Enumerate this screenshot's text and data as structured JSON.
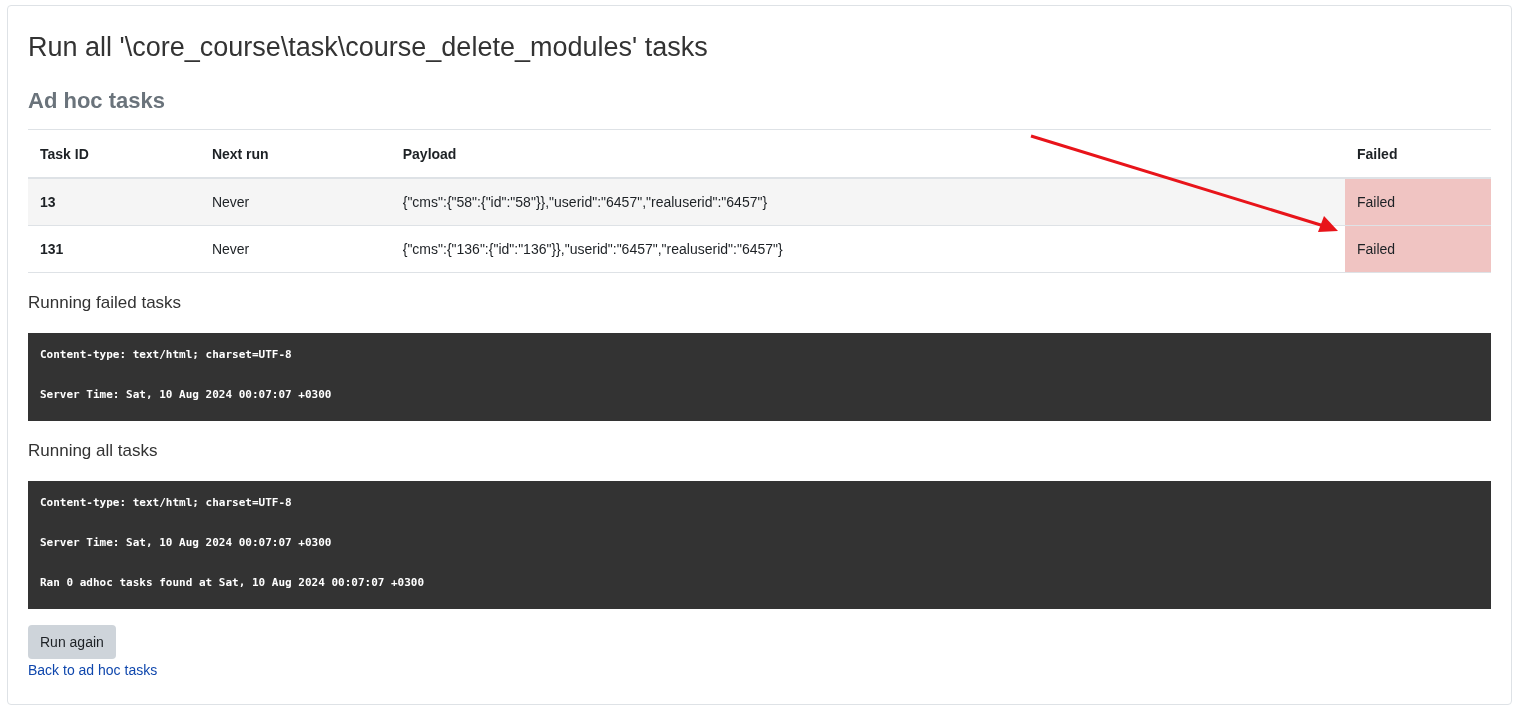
{
  "page": {
    "title": "Run all '\\core_course\\task\\course_delete_modules' tasks"
  },
  "section": {
    "heading": "Ad hoc tasks"
  },
  "table": {
    "columns": [
      "Task ID",
      "Next run",
      "Payload",
      "Failed"
    ],
    "rows": [
      {
        "task_id": "13",
        "next_run": "Never",
        "payload": "{\"cms\":{\"58\":{\"id\":\"58\"}},\"userid\":\"6457\",\"realuserid\":\"6457\"}",
        "failed": true,
        "status": "Failed"
      },
      {
        "task_id": "131",
        "next_run": "Never",
        "payload": "{\"cms\":{\"136\":{\"id\":\"136\"}},\"userid\":\"6457\",\"realuserid\":\"6457\"}",
        "failed": true,
        "status": "Failed"
      }
    ]
  },
  "outputs": [
    {
      "heading": "Running failed tasks",
      "lines": [
        "Content-type: text/html; charset=UTF-8",
        "Server Time: Sat, 10 Aug 2024 00:07:07 +0300"
      ]
    },
    {
      "heading": "Running all tasks",
      "lines": [
        "Content-type: text/html; charset=UTF-8",
        "Server Time: Sat, 10 Aug 2024 00:07:07 +0300",
        "Ran 0 adhoc tasks found at Sat, 10 Aug 2024 00:07:07 +0300"
      ]
    }
  ],
  "actions": {
    "button": "Run again",
    "link": "Back to ad hoc tasks"
  }
}
